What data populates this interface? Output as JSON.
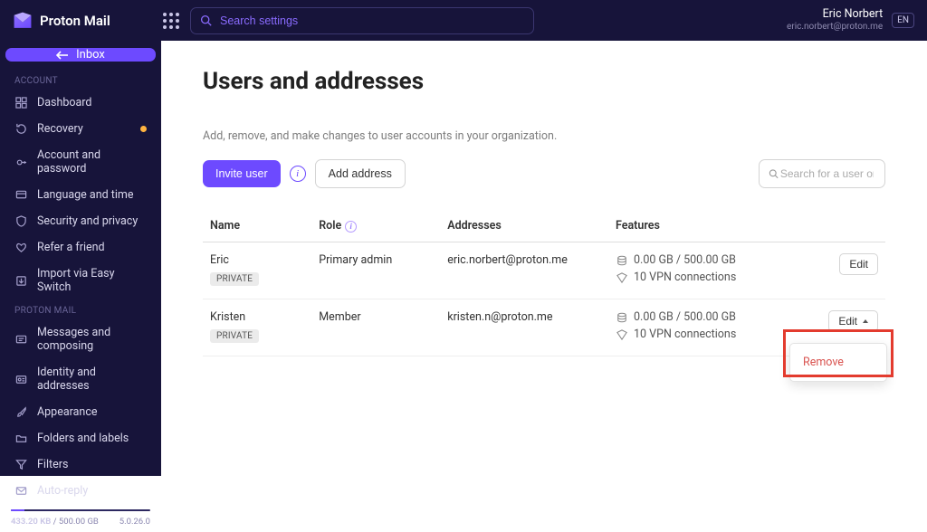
{
  "brand": {
    "name": "Proton Mail"
  },
  "header": {
    "search_placeholder": "Search settings",
    "user_name": "Eric Norbert",
    "user_email": "eric.norbert@proton.me",
    "language": "EN"
  },
  "sidebar": {
    "inbox_label": "Inbox",
    "sections": [
      {
        "label": "ACCOUNT",
        "items": [
          {
            "icon": "grid",
            "label": "Dashboard"
          },
          {
            "icon": "recovery",
            "label": "Recovery",
            "dot": true
          },
          {
            "icon": "key",
            "label": "Account and password"
          },
          {
            "icon": "globe",
            "label": "Language and time"
          },
          {
            "icon": "shield",
            "label": "Security and privacy"
          },
          {
            "icon": "heart",
            "label": "Refer a friend"
          },
          {
            "icon": "import",
            "label": "Import via Easy Switch"
          }
        ]
      },
      {
        "label": "PROTON MAIL",
        "items": [
          {
            "icon": "compose",
            "label": "Messages and composing"
          },
          {
            "icon": "id",
            "label": "Identity and addresses"
          },
          {
            "icon": "brush",
            "label": "Appearance"
          },
          {
            "icon": "folder",
            "label": "Folders and labels"
          },
          {
            "icon": "filter",
            "label": "Filters"
          },
          {
            "icon": "auto",
            "label": "Auto-reply"
          }
        ]
      }
    ],
    "quota_used": "433.20 KB",
    "quota_sep": " / ",
    "quota_total": "500.00 GB",
    "version": "5.0.26.0"
  },
  "main": {
    "title": "Users and addresses",
    "subtext": "Add, remove, and make changes to user accounts in your organization.",
    "invite_label": "Invite user",
    "add_address_label": "Add address",
    "table_search_placeholder": "Search for a user or address",
    "columns": {
      "name": "Name",
      "role": "Role",
      "addresses": "Addresses",
      "features": "Features"
    },
    "rows": [
      {
        "name": "Eric",
        "badge": "PRIVATE",
        "role": "Primary admin",
        "address": "eric.norbert@proton.me",
        "storage": "0.00 GB / 500.00 GB",
        "vpn": "10 VPN connections",
        "action": "Edit",
        "open": false
      },
      {
        "name": "Kristen",
        "badge": "PRIVATE",
        "role": "Member",
        "address": "kristen.n@proton.me",
        "storage": "0.00 GB / 500.00 GB",
        "vpn": "10 VPN connections",
        "action": "Edit",
        "open": true
      }
    ],
    "dropdown": {
      "remove": "Remove"
    }
  }
}
